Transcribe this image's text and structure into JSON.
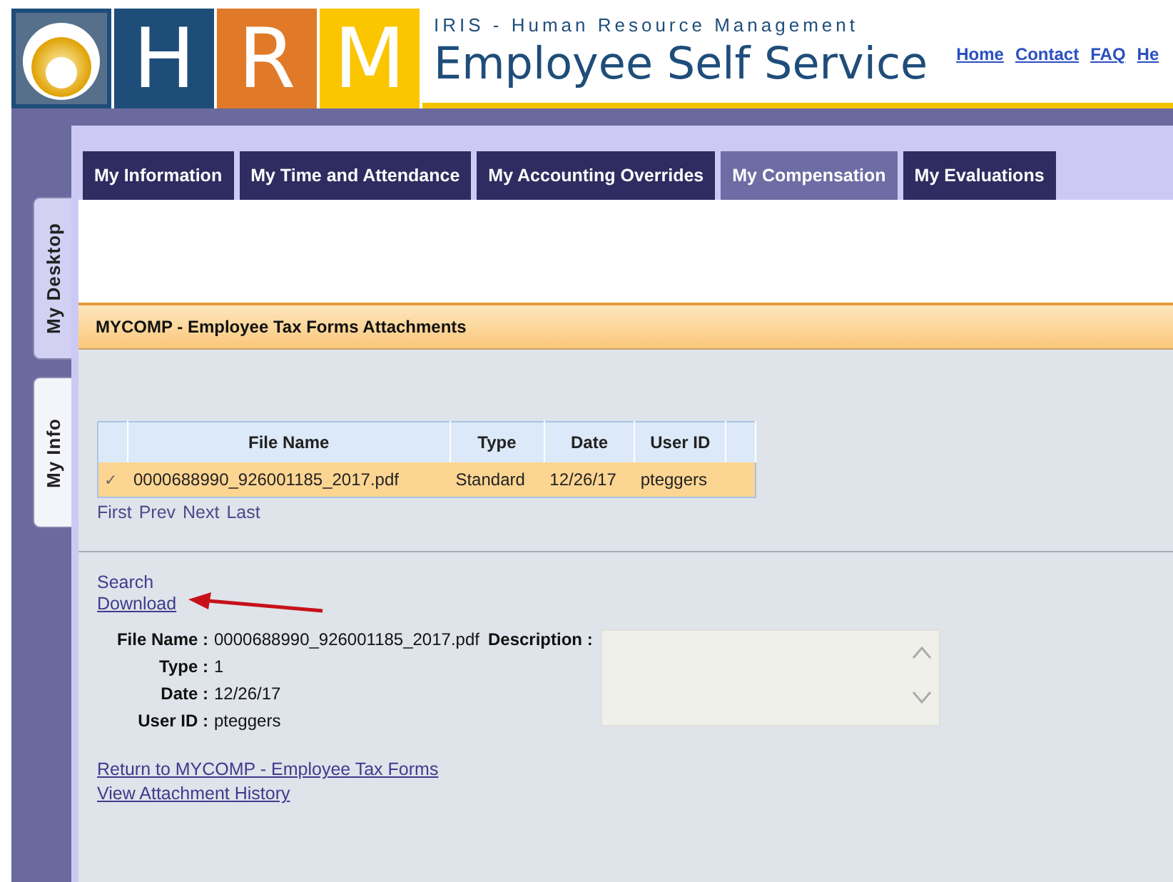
{
  "logo": {
    "letters": [
      "H",
      "R",
      "M"
    ]
  },
  "header": {
    "subtitle": "IRIS - Human Resource Management",
    "title": "Employee Self Service",
    "links": [
      "Home",
      "Contact",
      "FAQ",
      "He"
    ]
  },
  "side_tabs": [
    {
      "label": "My Desktop",
      "selected": false
    },
    {
      "label": "My Info",
      "selected": true
    }
  ],
  "tabs": [
    {
      "label": "My Information",
      "selected": false
    },
    {
      "label": "My Time and Attendance",
      "selected": false
    },
    {
      "label": "My Accounting Overrides",
      "selected": false
    },
    {
      "label": "My Compensation",
      "selected": true
    },
    {
      "label": "My Evaluations",
      "selected": false
    }
  ],
  "section_title": "MYCOMP - Employee Tax Forms Attachments",
  "table": {
    "columns": [
      "File Name",
      "Type",
      "Date",
      "User ID"
    ],
    "rows": [
      {
        "selected": true,
        "mark": "✓",
        "cells": [
          "0000688990_926001185_2017.pdf",
          "Standard",
          "12/26/17",
          "pteggers"
        ]
      }
    ]
  },
  "pager": [
    "First",
    "Prev",
    "Next",
    "Last"
  ],
  "actions": [
    {
      "label": "Search",
      "underlined": false
    },
    {
      "label": "Download",
      "underlined": true
    }
  ],
  "details": [
    {
      "label": "File Name :",
      "value": "0000688990_926001185_2017.pdf"
    },
    {
      "label": "Type :",
      "value": "1"
    },
    {
      "label": "Date :",
      "value": "12/26/17"
    },
    {
      "label": "User ID :",
      "value": "pteggers"
    }
  ],
  "description": {
    "label": "Description :"
  },
  "footer_links": [
    "Return to MYCOMP - Employee Tax Forms",
    "View Attachment History"
  ]
}
